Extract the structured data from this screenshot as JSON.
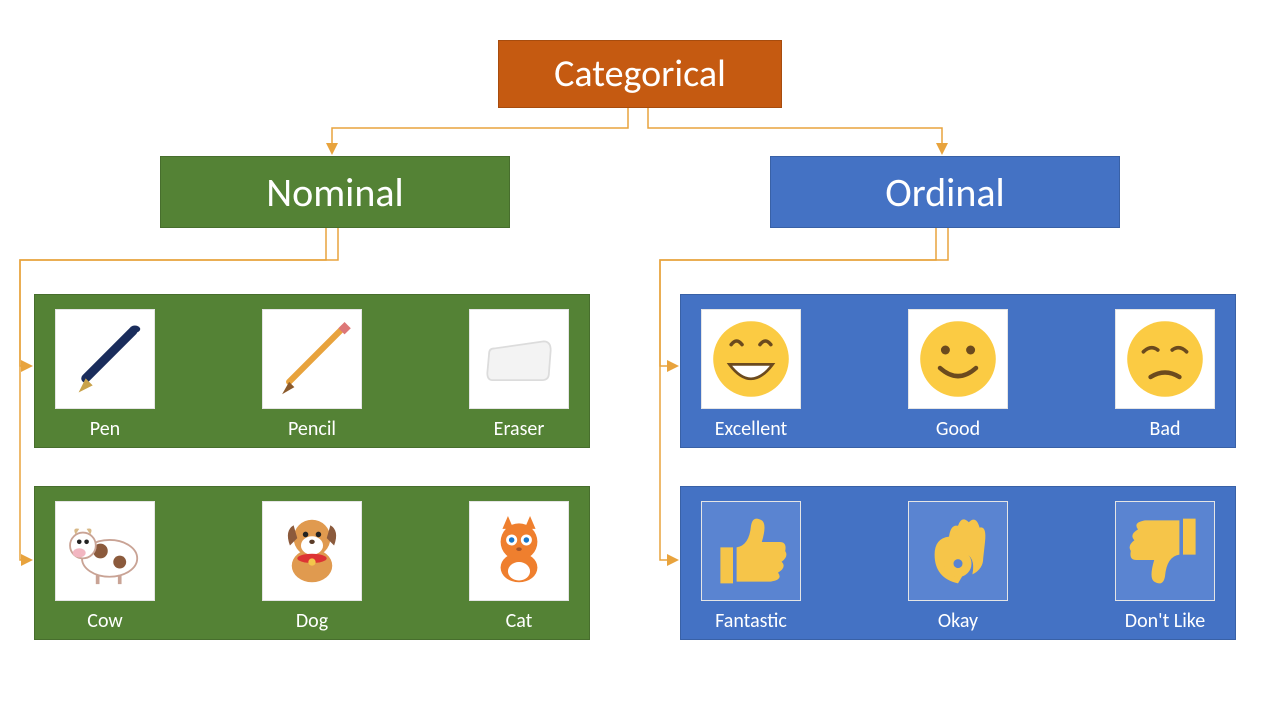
{
  "colors": {
    "orange": "#C55A11",
    "green": "#548235",
    "blue": "#4472C4",
    "arrow": "#E8A33D"
  },
  "root": {
    "label": "Categorical"
  },
  "branches": {
    "nominal": {
      "label": "Nominal"
    },
    "ordinal": {
      "label": "Ordinal"
    }
  },
  "nominal_sets": [
    {
      "items": [
        {
          "label": "Pen",
          "icon": "pen"
        },
        {
          "label": "Pencil",
          "icon": "pencil"
        },
        {
          "label": "Eraser",
          "icon": "eraser"
        }
      ]
    },
    {
      "items": [
        {
          "label": "Cow",
          "icon": "cow"
        },
        {
          "label": "Dog",
          "icon": "dog"
        },
        {
          "label": "Cat",
          "icon": "cat"
        }
      ]
    }
  ],
  "ordinal_sets": [
    {
      "items": [
        {
          "label": "Excellent",
          "icon": "grin"
        },
        {
          "label": "Good",
          "icon": "smile"
        },
        {
          "label": "Bad",
          "icon": "sad"
        }
      ]
    },
    {
      "items": [
        {
          "label": "Fantastic",
          "icon": "thumbs-up"
        },
        {
          "label": "Okay",
          "icon": "ok-hand"
        },
        {
          "label": "Don't Like",
          "icon": "thumbs-down"
        }
      ]
    }
  ]
}
